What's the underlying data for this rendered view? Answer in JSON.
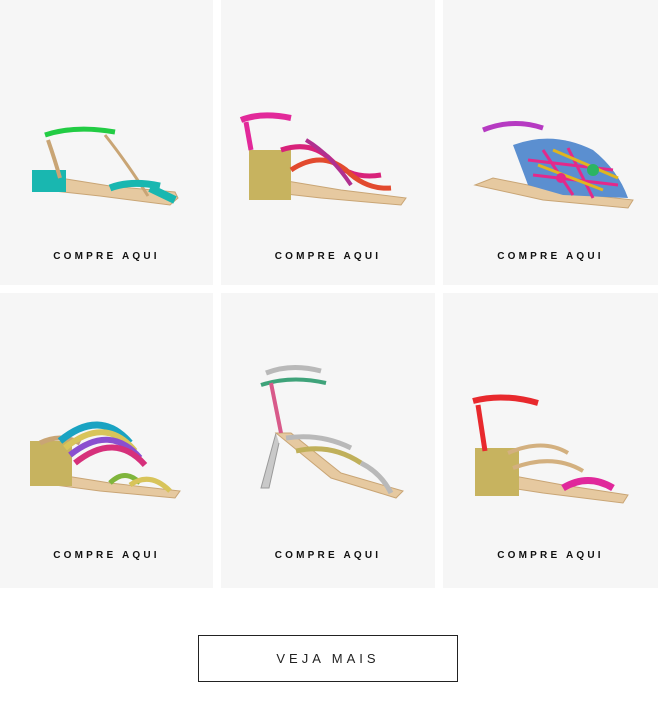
{
  "products": [
    {
      "cta": "COMPRE AQUI",
      "image": "sandal-green-turquoise"
    },
    {
      "cta": "COMPRE AQUI",
      "image": "sandal-pink-braided-block-heel"
    },
    {
      "cta": "COMPRE AQUI",
      "image": "sandal-woven-multicolor-flat"
    },
    {
      "cta": "COMPRE AQUI",
      "image": "sandal-metallic-strap-block-heel"
    },
    {
      "cta": "COMPRE AQUI",
      "image": "sandal-silver-braided-stiletto"
    },
    {
      "cta": "COMPRE AQUI",
      "image": "sandal-red-pink-block-heel"
    }
  ],
  "more_button": {
    "label": "VEJA MAIS"
  }
}
